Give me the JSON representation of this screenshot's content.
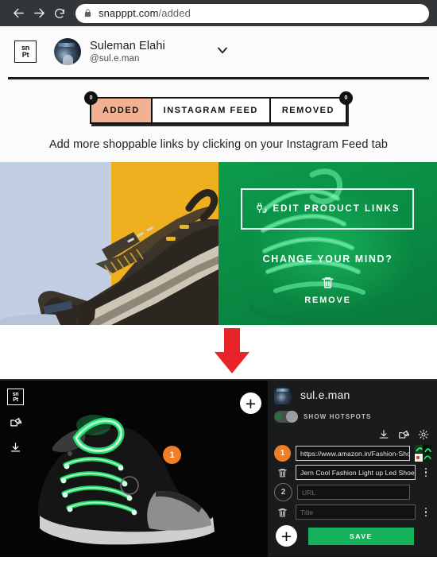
{
  "browser": {
    "back_icon": "arrow-left-icon",
    "forward_icon": "arrow-right-icon",
    "reload_icon": "reload-icon",
    "lock_icon": "lock-icon",
    "url_domain": "snapppt.com",
    "url_path": "/added"
  },
  "header": {
    "logo_line1": "sn",
    "logo_line2": "Pt",
    "user_name": "Suleman Elahi",
    "user_handle": "@sul.e.man",
    "chevron_icon": "chevron-down-icon"
  },
  "tabs": {
    "items": [
      {
        "label": "ADDED",
        "active": true
      },
      {
        "label": "INSTAGRAM FEED",
        "active": false
      },
      {
        "label": "REMOVED",
        "active": false
      }
    ],
    "badge_left": "0",
    "badge_right": "0"
  },
  "hint": {
    "text": "Add more shoppable links by clicking on your Instagram Feed tab"
  },
  "gallery": {
    "sandal_alt": "brown-sandal-product-photo",
    "shoe_overlay": {
      "edit_icon": "plug-link-icon",
      "edit_label": "EDIT PRODUCT LINKS",
      "change_mind": "CHANGE YOUR MIND?",
      "trash_icon": "trash-icon",
      "remove_label": "REMOVE"
    }
  },
  "arrow": {
    "icon": "down-arrow-icon",
    "color": "#e8232a"
  },
  "editor": {
    "side_logo_line1": "sn",
    "side_logo_line2": "Pt",
    "share_icon": "share-icon",
    "download_icon": "download-icon",
    "hotspot_marker_1": "1",
    "add_hotspot_icon": "plus-circle-icon",
    "account_name": "sul.e.man",
    "show_hotspots_label": "SHOW HOTSPOTS",
    "toolbar": {
      "download_icon": "download-icon",
      "share_icon": "share-icon",
      "settings_icon": "gear-icon"
    },
    "rows": [
      {
        "number": "1",
        "url_value": "https://www.amazon.in/Fashion-Shoelace",
        "title_value": "Jern Cool Fashion Light up Led Shoelaces F",
        "trash_icon": "trash-icon",
        "kebab_icon": "more-vertical-icon",
        "thumbnail": "product-thumbnail"
      },
      {
        "number": "2",
        "url_placeholder": "URL",
        "title_placeholder": "Title",
        "trash_icon": "trash-icon",
        "kebab_icon": "more-vertical-icon"
      }
    ],
    "add_row_icon": "plus-circle-icon",
    "save_label": "SAVE",
    "save_color": "#18b15c"
  }
}
